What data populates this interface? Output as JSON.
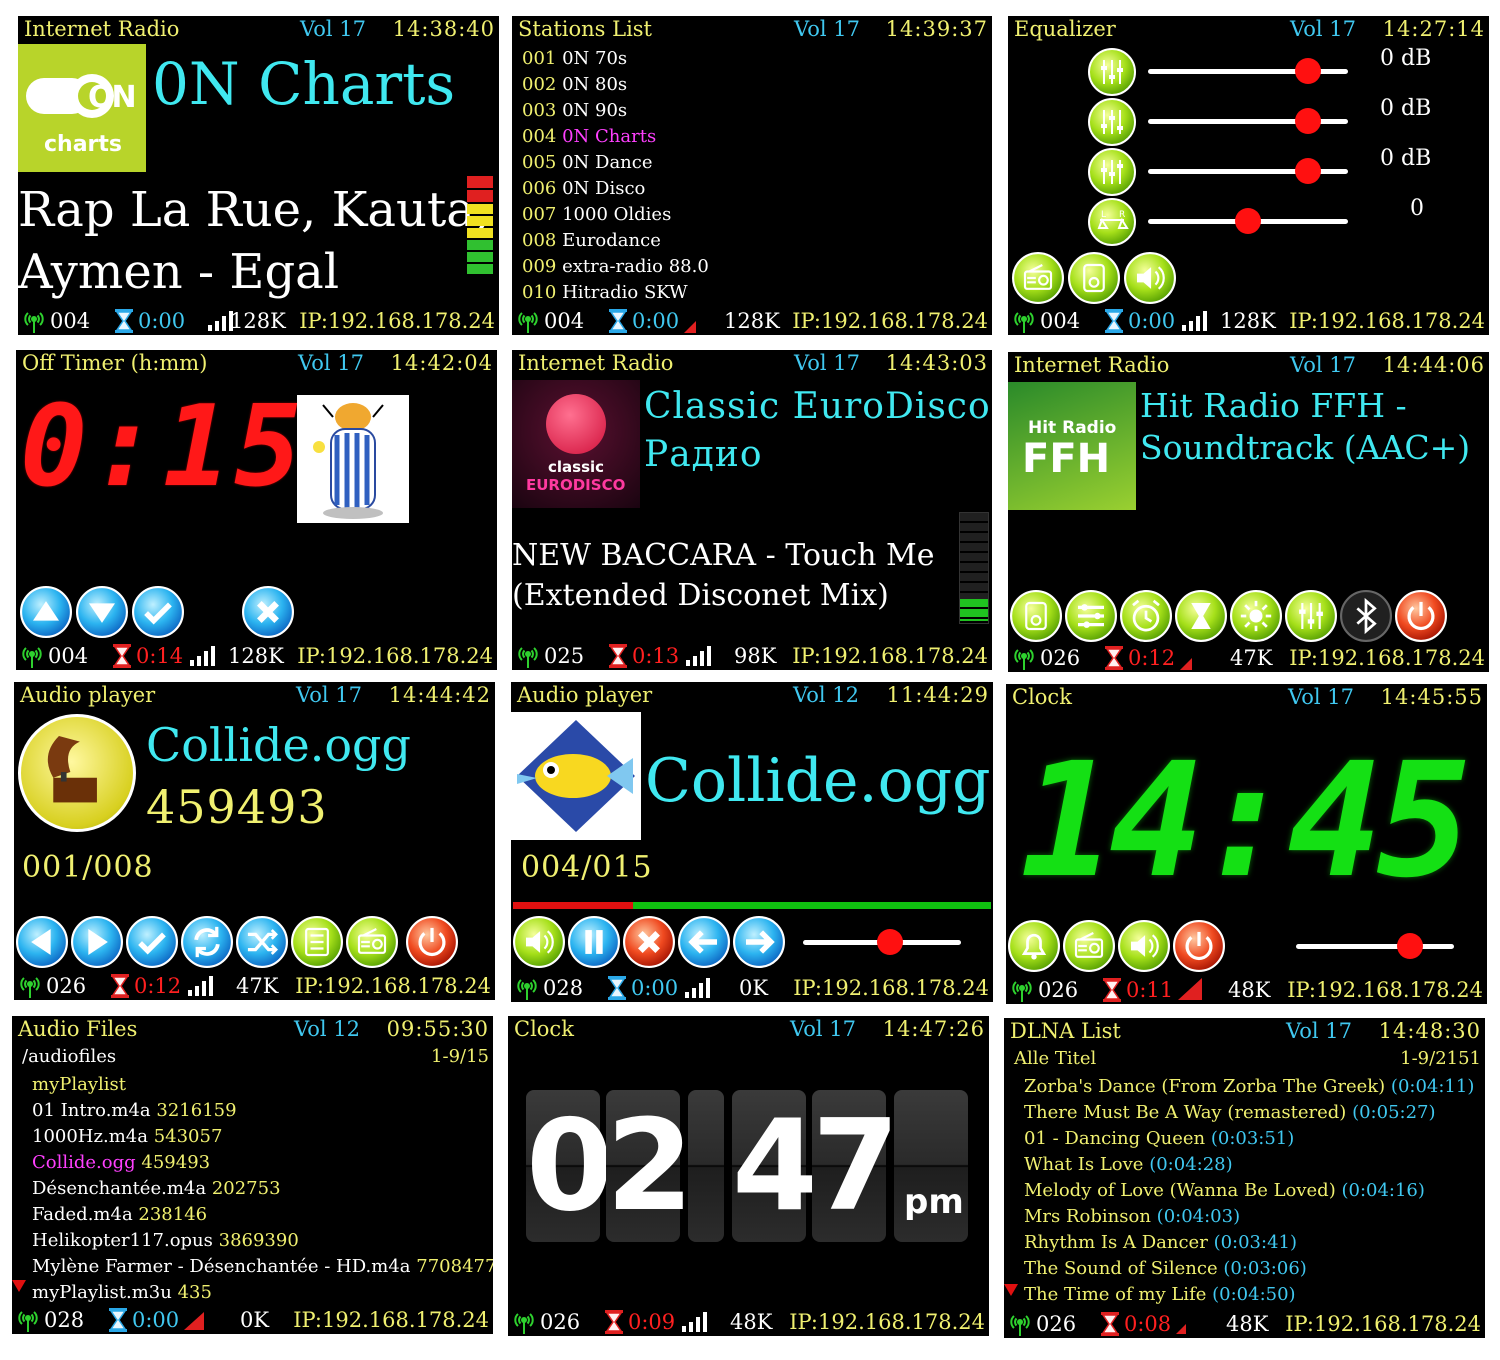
{
  "ip": "IP:192.168.178.24",
  "p1": {
    "title": "Internet Radio",
    "vol": "Vol 17",
    "clock": "14:38:40",
    "station": "0N Charts",
    "logo_main": "ON",
    "logo_sub": "charts",
    "track": [
      "Rap La Rue, Kauta,",
      "Aymen - Egal"
    ],
    "num": "004",
    "time": "0:00",
    "kb": "128K"
  },
  "p2": {
    "title": "Stations List",
    "vol": "Vol 17",
    "clock": "14:39:37",
    "items": [
      {
        "n": "001",
        "name": "0N 70s"
      },
      {
        "n": "002",
        "name": "0N 80s"
      },
      {
        "n": "003",
        "name": "0N 90s"
      },
      {
        "n": "004",
        "name": "0N Charts"
      },
      {
        "n": "005",
        "name": "0N Dance"
      },
      {
        "n": "006",
        "name": "0N Disco"
      },
      {
        "n": "007",
        "name": "1000 Oldies"
      },
      {
        "n": "008",
        "name": "Eurodance"
      },
      {
        "n": "009",
        "name": "extra-radio 88.0"
      },
      {
        "n": "010",
        "name": "Hitradio SKW"
      }
    ],
    "num": "004",
    "time": "0:00",
    "kb": "128K"
  },
  "p3": {
    "title": "Equalizer",
    "vol": "Vol 17",
    "clock": "14:27:14",
    "values": [
      "0 dB",
      "0 dB",
      "0 dB",
      "0"
    ],
    "levels": [
      0.8,
      0.8,
      0.8,
      0.5
    ],
    "num": "004",
    "time": "0:00",
    "kb": "128K"
  },
  "p4": {
    "title": "Off Timer (h:mm)",
    "vol": "Vol 17",
    "clock": "14:42:04",
    "timer": "0:15",
    "num": "004",
    "time": "0:14",
    "kb": "128K"
  },
  "p5": {
    "title": "Internet Radio",
    "vol": "Vol 17",
    "clock": "14:43:03",
    "station": [
      "Classic EuroDisco",
      "Радио"
    ],
    "logo_top": "classic",
    "logo_bottom": "EURODISCO",
    "track": [
      "NEW BACCARA - Touch Me",
      "(Extended Disconet Mix)"
    ],
    "num": "025",
    "time": "0:13",
    "kb": "98K"
  },
  "p6": {
    "title": "Internet Radio",
    "vol": "Vol 17",
    "clock": "14:44:06",
    "station": [
      "Hit Radio FFH -",
      "Soundtrack (AAC+)"
    ],
    "logo_top": "Hit Radio",
    "logo_bottom": "FFH",
    "num": "026",
    "time": "0:12",
    "kb": "47K"
  },
  "p7": {
    "title": "Audio player",
    "vol": "Vol 17",
    "clock": "14:44:42",
    "file": "Collide.ogg",
    "size": "459493",
    "pos": "001/008",
    "num": "026",
    "time": "0:12",
    "kb": "47K"
  },
  "p8": {
    "title": "Audio player",
    "vol": "Vol 12",
    "clock": "11:44:29",
    "file": "Collide.ogg",
    "pos": "004/015",
    "progress": 0.25,
    "volume": 0.55,
    "num": "028",
    "time": "0:00",
    "kb": "0K"
  },
  "p9": {
    "title": "Clock",
    "vol": "Vol 17",
    "clock": "14:45:55",
    "time_display": "14:45",
    "volume": 0.72,
    "num": "026",
    "time": "0:11",
    "kb": "48K"
  },
  "p10": {
    "title": "Audio Files",
    "vol": "Vol 12",
    "clock": "09:55:30",
    "path": "/audiofiles",
    "page": "1-9/15",
    "items": [
      {
        "name": "myPlaylist",
        "size": ""
      },
      {
        "name": "01 Intro.m4a",
        "size": "3216159"
      },
      {
        "name": "1000Hz.m4a",
        "size": "543057"
      },
      {
        "name": "Collide.ogg",
        "size": "459493"
      },
      {
        "name": "Désenchantée.m4a",
        "size": "202753"
      },
      {
        "name": "Faded.m4a",
        "size": "238146"
      },
      {
        "name": "Helikopter117.opus",
        "size": "3869390"
      },
      {
        "name": "Mylène Farmer - Désenchantée - HD.m4a",
        "size": "7708477"
      },
      {
        "name": "myPlaylist.m3u",
        "size": "435"
      }
    ],
    "num": "028",
    "time": "0:00",
    "kb": "0K"
  },
  "p11": {
    "title": "Clock",
    "vol": "Vol 17",
    "clock": "14:47:26",
    "digits": [
      "0",
      "2",
      "4",
      "7"
    ],
    "ampm": "pm",
    "num": "026",
    "time": "0:09",
    "kb": "48K"
  },
  "p12": {
    "title": "DLNA List",
    "vol": "Vol 17",
    "clock": "14:48:30",
    "folder": "Alle Titel",
    "page": "1-9/2151",
    "items": [
      {
        "name": "Zorba's Dance (From Zorba The Greek)",
        "dur": "(0:04:11)"
      },
      {
        "name": "There Must Be A Way (remastered)",
        "dur": "(0:05:27)"
      },
      {
        "name": "01 - Dancing Queen",
        "dur": "(0:03:51)"
      },
      {
        "name": "What Is Love",
        "dur": "(0:04:28)"
      },
      {
        "name": "Melody of Love (Wanna Be Loved)",
        "dur": "(0:04:16)"
      },
      {
        "name": "Mrs Robinson",
        "dur": "(0:04:03)"
      },
      {
        "name": "Rhythm Is A Dancer",
        "dur": "(0:03:41)"
      },
      {
        "name": "The Sound of Silence",
        "dur": "(0:03:06)"
      },
      {
        "name": "The Time of my Life",
        "dur": "(0:04:50)"
      }
    ],
    "num": "026",
    "time": "0:08",
    "kb": "48K"
  }
}
